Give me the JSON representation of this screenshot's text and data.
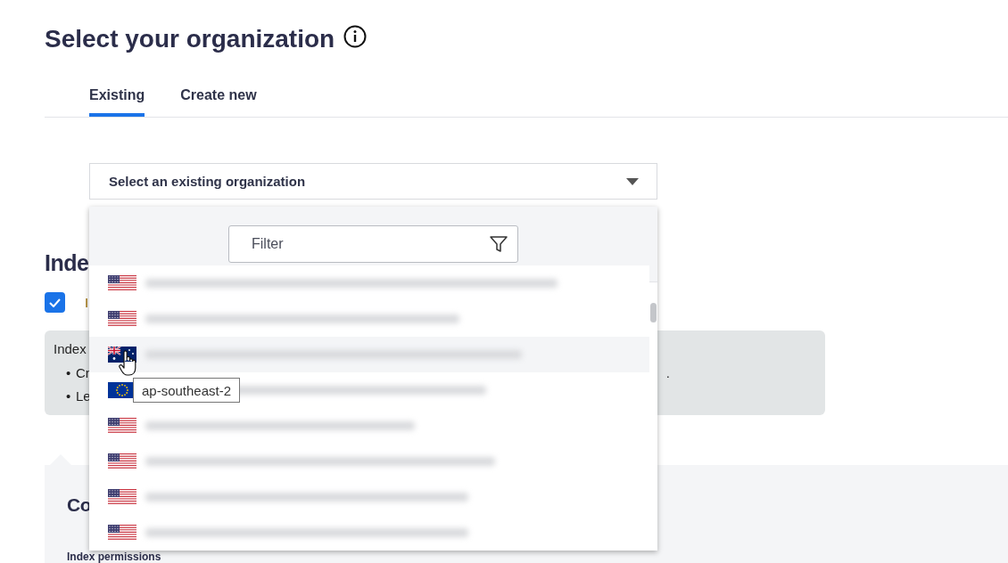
{
  "page": {
    "title": "Select your organization"
  },
  "tabs": [
    {
      "label": "Existing",
      "selected": true
    },
    {
      "label": "Create new",
      "selected": false
    }
  ],
  "organization_select": {
    "value": "Select an existing organization",
    "expanded": true
  },
  "dropdown": {
    "filter": {
      "placeholder": "Filter"
    },
    "options": [
      {
        "kind": "us",
        "hovered": false
      },
      {
        "kind": "us",
        "hovered": false
      },
      {
        "kind": "au",
        "hovered": true
      },
      {
        "kind": "eu",
        "hovered": false
      },
      {
        "kind": "us",
        "hovered": false
      },
      {
        "kind": "us",
        "hovered": false
      },
      {
        "kind": "us",
        "hovered": false
      },
      {
        "kind": "us",
        "hovered": false
      }
    ],
    "tooltip": "ap-southeast-2"
  },
  "background": {
    "section_heading": "Inde",
    "checkbox": {
      "checked": true,
      "label": "I"
    },
    "info_box": {
      "title": "Index",
      "bullets": [
        {
          "marker": "•",
          "text": "Cr"
        },
        {
          "marker": "•",
          "text": "Le"
        }
      ],
      "trailing": "."
    },
    "panel": {
      "heading": "Co",
      "subheading": "Index permissions"
    }
  }
}
